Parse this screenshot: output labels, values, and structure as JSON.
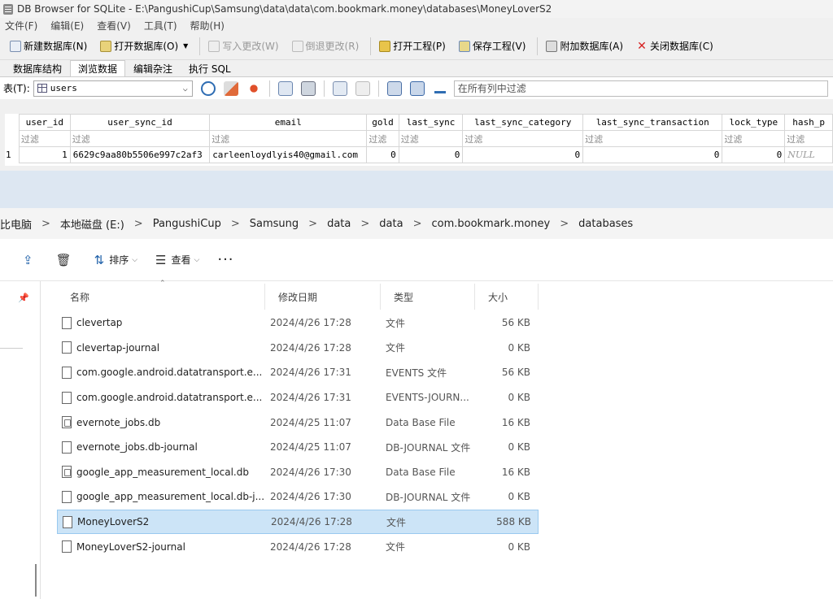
{
  "db": {
    "title": "DB Browser for SQLite - E:\\PangushiCup\\Samsung\\data\\data\\com.bookmark.money\\databases\\MoneyLoverS2",
    "menu": [
      "文件(F)",
      "编辑(E)",
      "查看(V)",
      "工具(T)",
      "帮助(H)"
    ],
    "toolbar": {
      "new_db": "新建数据库(N)",
      "open_db": "打开数据库(O)",
      "write": "写入更改(W)",
      "revert": "倒退更改(R)",
      "open_project": "打开工程(P)",
      "save_project": "保存工程(V)",
      "attach_db": "附加数据库(A)",
      "close_db": "关闭数据库(C)"
    },
    "tabs": [
      "数据库结构",
      "浏览数据",
      "编辑杂注",
      "执行 SQL"
    ],
    "table_label": "表(T):",
    "table_name": "users",
    "filter_all_placeholder": "在所有列中过滤",
    "filter_text": "过滤",
    "columns": [
      "user_id",
      "user_sync_id",
      "email",
      "gold",
      "last_sync",
      "last_sync_category",
      "last_sync_transaction",
      "lock_type",
      "hash_p"
    ],
    "row": {
      "num": "1",
      "user_id": "1",
      "user_sync_id": "6629c9aa80b5506e997c2af3",
      "email": "carleenloydlyis40@gmail.com",
      "gold": "0",
      "last_sync": "0",
      "last_sync_category": "0",
      "last_sync_transaction": "0",
      "lock_type": "0",
      "hash_p": "NULL"
    }
  },
  "explorer": {
    "breadcrumb": [
      "比电脑",
      "本地磁盘 (E:)",
      "PangushiCup",
      "Samsung",
      "data",
      "data",
      "com.bookmark.money",
      "databases"
    ],
    "commands": {
      "sort": "排序",
      "view": "查看"
    },
    "headers": {
      "name": "名称",
      "date": "修改日期",
      "type": "类型",
      "size": "大小"
    },
    "files": [
      {
        "name": "clevertap",
        "date": "2024/4/26 17:28",
        "type": "文件",
        "size": "56 KB",
        "icon": "file-icon"
      },
      {
        "name": "clevertap-journal",
        "date": "2024/4/26 17:28",
        "type": "文件",
        "size": "0 KB",
        "icon": "file-icon"
      },
      {
        "name": "com.google.android.datatransport.e...",
        "date": "2024/4/26 17:31",
        "type": "EVENTS 文件",
        "size": "56 KB",
        "icon": "file-icon"
      },
      {
        "name": "com.google.android.datatransport.e...",
        "date": "2024/4/26 17:31",
        "type": "EVENTS-JOURN...",
        "size": "0 KB",
        "icon": "file-icon"
      },
      {
        "name": "evernote_jobs.db",
        "date": "2024/4/25 11:07",
        "type": "Data Base File",
        "size": "16 KB",
        "icon": "database-file-icon"
      },
      {
        "name": "evernote_jobs.db-journal",
        "date": "2024/4/25 11:07",
        "type": "DB-JOURNAL 文件",
        "size": "0 KB",
        "icon": "file-icon"
      },
      {
        "name": "google_app_measurement_local.db",
        "date": "2024/4/26 17:30",
        "type": "Data Base File",
        "size": "16 KB",
        "icon": "database-file-icon"
      },
      {
        "name": "google_app_measurement_local.db-j...",
        "date": "2024/4/26 17:30",
        "type": "DB-JOURNAL 文件",
        "size": "0 KB",
        "icon": "file-icon"
      },
      {
        "name": "MoneyLoverS2",
        "date": "2024/4/26 17:28",
        "type": "文件",
        "size": "588 KB",
        "icon": "file-icon",
        "selected": true
      },
      {
        "name": "MoneyLoverS2-journal",
        "date": "2024/4/26 17:28",
        "type": "文件",
        "size": "0 KB",
        "icon": "file-icon"
      }
    ]
  }
}
